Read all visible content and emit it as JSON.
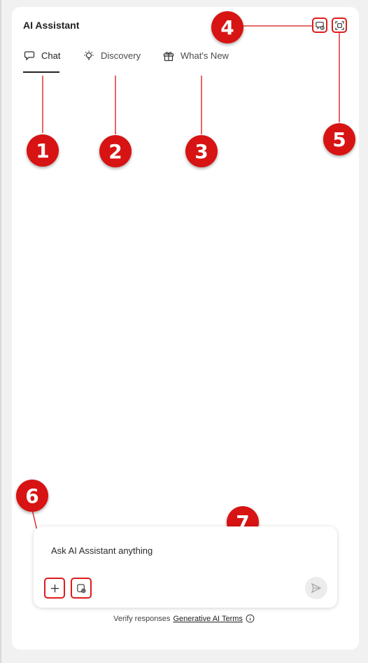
{
  "header": {
    "title": "AI Assistant"
  },
  "tabs": [
    {
      "label": "Chat",
      "icon": "chat-bubbles-icon",
      "active": true
    },
    {
      "label": "Discovery",
      "icon": "lightbulb-icon",
      "active": false
    },
    {
      "label": "What's New",
      "icon": "gift-icon",
      "active": false
    }
  ],
  "toolbar": {
    "history_icon": "chat-history-icon",
    "expand_icon": "expand-panel-icon"
  },
  "composer": {
    "placeholder": "Ask AI Assistant anything",
    "add_icon": "plus-icon",
    "settings_icon": "document-settings-icon",
    "send_icon": "send-icon"
  },
  "footer": {
    "text": "Verify responses",
    "link": "Generative AI Terms"
  },
  "callouts": [
    "1",
    "2",
    "3",
    "4",
    "5",
    "6",
    "7"
  ],
  "colors": {
    "callout": "#d71313",
    "highlight_border": "#e01b1b"
  }
}
